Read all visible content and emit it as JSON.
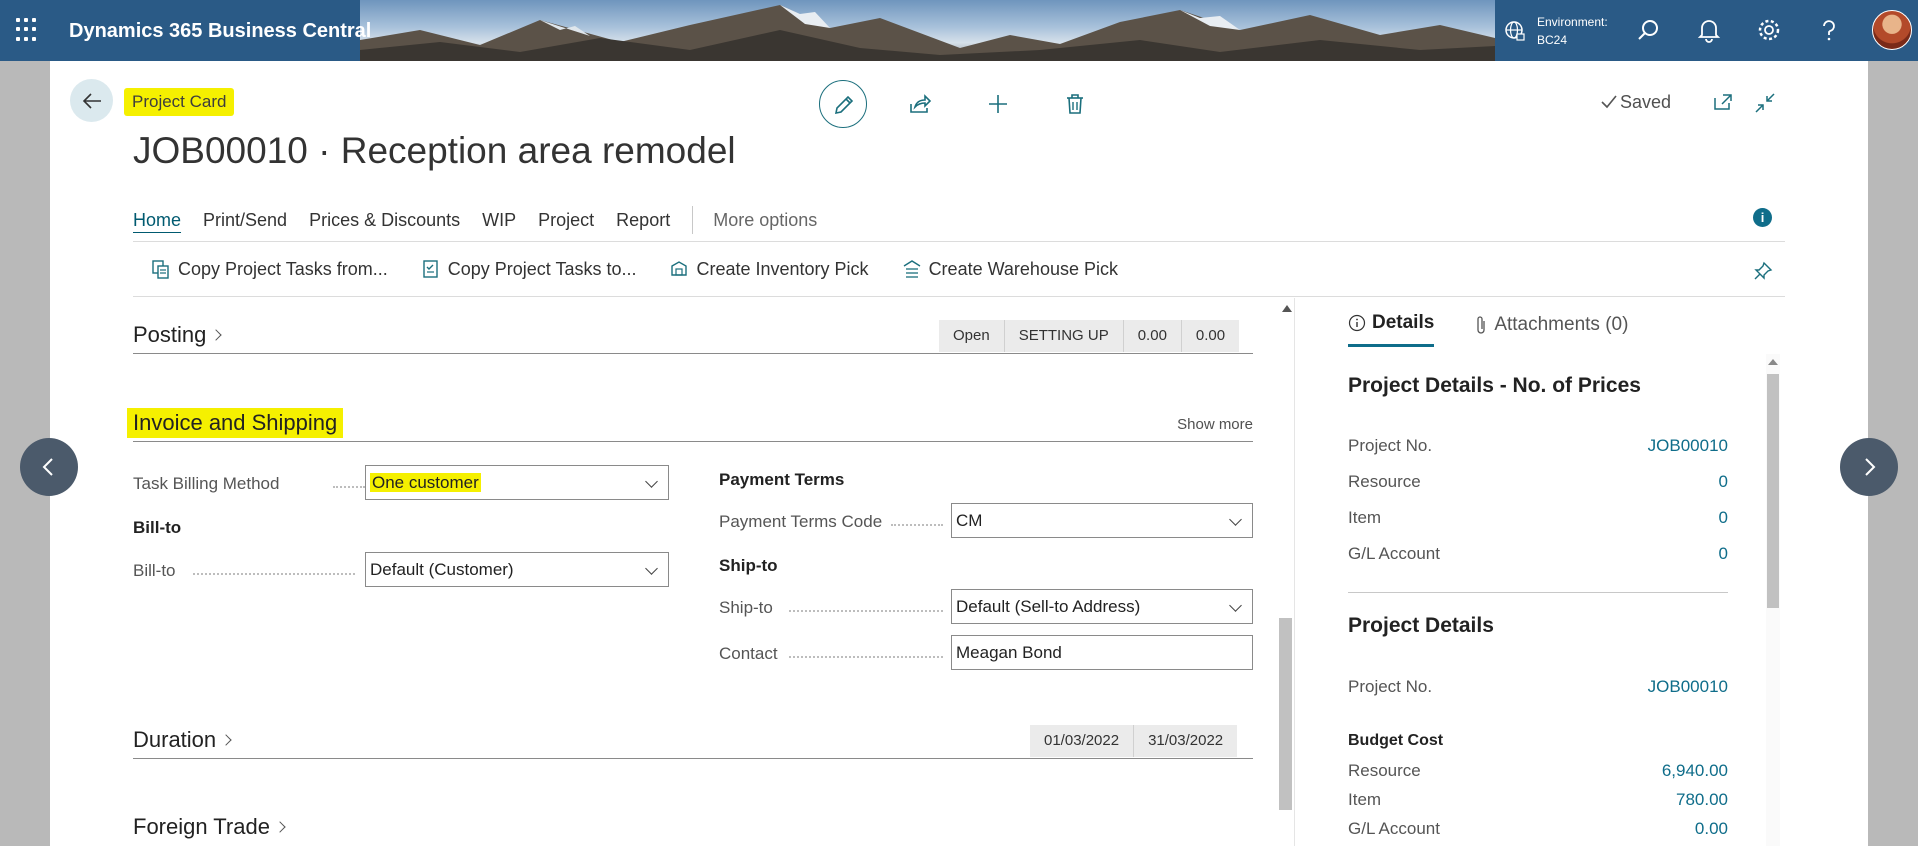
{
  "header": {
    "app_title": "Dynamics 365 Business Central",
    "environment_label": "Environment:",
    "environment_value": "BC24",
    "icons": [
      "app-launcher-icon",
      "globe-icon",
      "search-icon",
      "bell-icon",
      "gear-icon",
      "help-icon",
      "avatar"
    ]
  },
  "page": {
    "caption": "Project Card",
    "title": "JOB00010 · Reception area remodel",
    "status": "Saved"
  },
  "actions": {
    "menu": [
      "Home",
      "Print/Send",
      "Prices & Discounts",
      "WIP",
      "Project",
      "Report"
    ],
    "more_options": "More options",
    "promoted": [
      "Copy Project Tasks from...",
      "Copy Project Tasks to...",
      "Create Inventory Pick",
      "Create Warehouse Pick"
    ]
  },
  "posting": {
    "title": "Posting",
    "summary": [
      "Open",
      "SETTING UP",
      "0.00",
      "0.00"
    ]
  },
  "invoice_shipping": {
    "title": "Invoice and Shipping",
    "show_more": "Show more",
    "task_billing_method_label": "Task Billing Method",
    "task_billing_method_value": "One customer",
    "bill_to_group": "Bill-to",
    "bill_to_label": "Bill-to",
    "bill_to_value": "Default (Customer)",
    "payment_terms_group": "Payment Terms",
    "payment_terms_code_label": "Payment Terms Code",
    "payment_terms_code_value": "CM",
    "ship_to_group": "Ship-to",
    "ship_to_label": "Ship-to",
    "ship_to_value": "Default (Sell-to Address)",
    "contact_label": "Contact",
    "contact_value": "Meagan Bond"
  },
  "duration": {
    "title": "Duration",
    "summary": [
      "01/03/2022",
      "31/03/2022"
    ]
  },
  "foreign_trade": {
    "title": "Foreign Trade"
  },
  "factbox": {
    "tabs": [
      "Details",
      "Attachments (0)"
    ],
    "prices_title": "Project Details - No. of Prices",
    "prices_rows": [
      {
        "label": "Project No.",
        "value": "JOB00010"
      },
      {
        "label": "Resource",
        "value": "0"
      },
      {
        "label": "Item",
        "value": "0"
      },
      {
        "label": "G/L Account",
        "value": "0"
      }
    ],
    "details_title": "Project Details",
    "details_project_label": "Project No.",
    "details_project_value": "JOB00010",
    "budget_cost_title": "Budget Cost",
    "budget_rows": [
      {
        "label": "Resource",
        "value": "6,940.00"
      },
      {
        "label": "Item",
        "value": "780.00"
      },
      {
        "label": "G/L Account",
        "value": "0.00"
      }
    ]
  },
  "colors": {
    "accent": "#0f6d8a",
    "highlight": "#f5f000",
    "topbar": "#2a5a86"
  }
}
